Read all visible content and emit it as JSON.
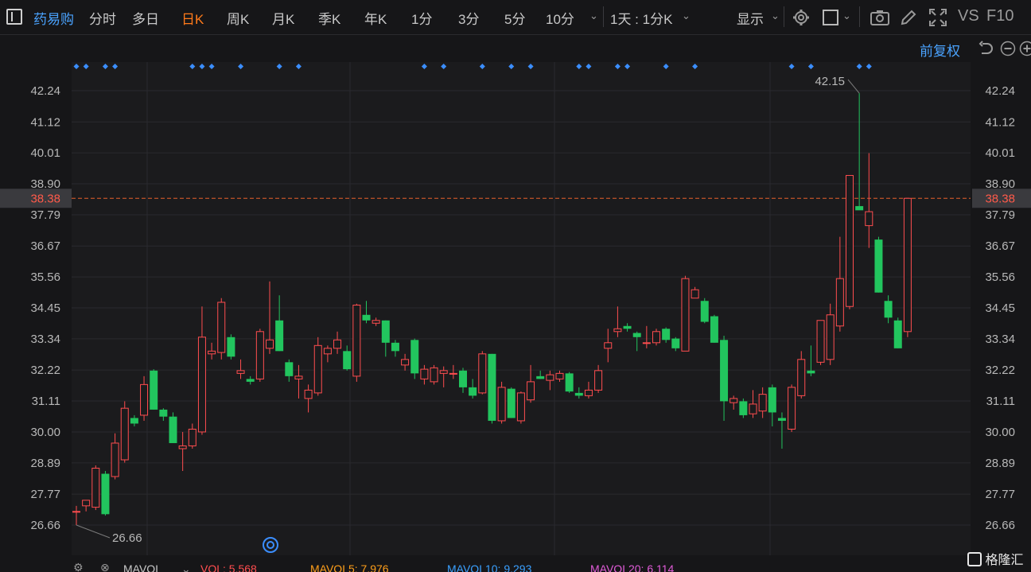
{
  "toolbar": {
    "stock_name": "药易购",
    "tabs": [
      "分时",
      "多日",
      "日K",
      "周K",
      "月K",
      "季K",
      "年K",
      "1分",
      "3分",
      "5分",
      "10分"
    ],
    "active_tab": "日K",
    "period_select": "1天 : 1分K",
    "display_label": "显示",
    "vs_label": "VS",
    "f10_label": "F10",
    "adjust_label": "前复权"
  },
  "chart_data": {
    "type": "candlestick",
    "y_ticks": [
      42.24,
      41.12,
      40.01,
      38.9,
      37.79,
      36.67,
      35.56,
      34.45,
      33.34,
      32.22,
      31.11,
      30.0,
      28.89,
      27.77,
      26.66
    ],
    "ylim": [
      25.9,
      43.2
    ],
    "current_price": 38.38,
    "high_label": "42.15",
    "low_label": "26.66",
    "up_color": "#ff4d4f",
    "down_color": "#22c55e",
    "ohlc": [
      [
        27.15,
        27.35,
        26.66,
        27.15
      ],
      [
        27.35,
        27.55,
        27.15,
        27.55
      ],
      [
        27.3,
        28.8,
        27.2,
        28.7
      ],
      [
        28.5,
        28.6,
        27.0,
        27.05
      ],
      [
        28.4,
        29.95,
        28.3,
        29.6
      ],
      [
        29.0,
        31.1,
        28.9,
        30.85
      ],
      [
        30.5,
        30.6,
        30.2,
        30.3
      ],
      [
        30.6,
        32.0,
        30.4,
        31.7
      ],
      [
        32.2,
        32.25,
        30.8,
        30.8
      ],
      [
        30.8,
        30.85,
        30.4,
        30.55
      ],
      [
        30.55,
        30.7,
        29.6,
        29.6
      ],
      [
        29.4,
        30.0,
        28.6,
        29.5
      ],
      [
        29.5,
        30.3,
        29.4,
        30.1
      ],
      [
        30.0,
        34.5,
        29.9,
        33.4
      ],
      [
        32.8,
        33.2,
        32.6,
        32.9
      ],
      [
        32.85,
        34.8,
        32.6,
        34.65
      ],
      [
        33.4,
        33.5,
        32.6,
        32.7
      ],
      [
        32.1,
        32.6,
        31.9,
        32.2
      ],
      [
        31.9,
        32.0,
        31.7,
        31.8
      ],
      [
        31.9,
        33.7,
        31.8,
        33.6
      ],
      [
        33.0,
        35.4,
        32.8,
        33.3
      ],
      [
        34.0,
        34.9,
        32.9,
        32.9
      ],
      [
        32.5,
        32.6,
        31.8,
        32.0
      ],
      [
        31.9,
        32.4,
        31.2,
        32.0
      ],
      [
        31.2,
        31.7,
        30.7,
        31.5
      ],
      [
        31.4,
        33.4,
        31.3,
        33.1
      ],
      [
        32.8,
        33.1,
        32.5,
        33.0
      ],
      [
        33.0,
        33.6,
        32.8,
        33.3
      ],
      [
        32.9,
        33.1,
        32.2,
        32.25
      ],
      [
        32.0,
        34.6,
        31.8,
        34.55
      ],
      [
        34.2,
        34.7,
        33.9,
        34.0
      ],
      [
        33.9,
        34.1,
        33.8,
        34.0
      ],
      [
        34.0,
        34.0,
        32.7,
        33.2
      ],
      [
        33.2,
        33.3,
        32.7,
        32.9
      ],
      [
        32.4,
        32.8,
        32.2,
        32.6
      ],
      [
        33.3,
        33.35,
        31.9,
        32.1
      ],
      [
        31.9,
        32.4,
        31.7,
        32.25
      ],
      [
        31.8,
        32.4,
        31.7,
        32.3
      ],
      [
        32.1,
        32.35,
        31.6,
        32.2
      ],
      [
        32.1,
        32.4,
        31.9,
        32.1
      ],
      [
        32.2,
        32.3,
        31.4,
        31.6
      ],
      [
        31.6,
        31.9,
        31.2,
        31.3
      ],
      [
        31.4,
        32.9,
        31.35,
        32.8
      ],
      [
        32.8,
        32.8,
        30.3,
        30.4
      ],
      [
        30.4,
        31.8,
        30.3,
        31.6
      ],
      [
        31.55,
        31.6,
        30.5,
        30.5
      ],
      [
        30.4,
        31.45,
        30.3,
        31.4
      ],
      [
        31.15,
        32.4,
        31.05,
        31.8
      ],
      [
        32.0,
        32.2,
        31.9,
        31.9
      ],
      [
        31.85,
        32.2,
        31.5,
        32.05
      ],
      [
        31.9,
        32.2,
        31.8,
        32.1
      ],
      [
        32.1,
        32.15,
        31.4,
        31.45
      ],
      [
        31.4,
        31.6,
        31.2,
        31.3
      ],
      [
        31.3,
        31.8,
        31.2,
        31.5
      ],
      [
        31.5,
        32.4,
        31.4,
        32.2
      ],
      [
        33.0,
        33.7,
        32.5,
        33.2
      ],
      [
        33.6,
        34.5,
        33.4,
        33.7
      ],
      [
        33.8,
        33.9,
        33.6,
        33.7
      ],
      [
        33.55,
        33.6,
        32.9,
        33.4
      ],
      [
        33.2,
        33.8,
        33.0,
        33.2
      ],
      [
        33.2,
        33.7,
        33.1,
        33.6
      ],
      [
        33.7,
        33.75,
        33.2,
        33.3
      ],
      [
        33.35,
        33.4,
        32.9,
        33.0
      ],
      [
        32.9,
        35.6,
        32.9,
        35.5
      ],
      [
        34.8,
        35.2,
        34.8,
        35.1
      ],
      [
        34.7,
        34.8,
        33.9,
        33.95
      ],
      [
        34.15,
        34.2,
        33.2,
        33.2
      ],
      [
        33.3,
        33.45,
        30.4,
        31.1
      ],
      [
        31.05,
        31.3,
        30.8,
        31.2
      ],
      [
        31.1,
        31.2,
        30.5,
        30.6
      ],
      [
        30.65,
        31.5,
        30.5,
        31.0
      ],
      [
        30.75,
        31.6,
        30.5,
        31.35
      ],
      [
        31.6,
        31.7,
        30.2,
        30.7
      ],
      [
        30.5,
        30.7,
        29.4,
        30.4
      ],
      [
        30.1,
        31.7,
        30.0,
        31.6
      ],
      [
        31.3,
        32.9,
        31.2,
        32.6
      ],
      [
        32.2,
        33.1,
        32.0,
        32.1
      ],
      [
        32.5,
        33.1,
        32.4,
        34.0
      ],
      [
        32.6,
        34.6,
        32.4,
        34.2
      ],
      [
        33.8,
        37.0,
        33.6,
        35.5
      ],
      [
        34.5,
        38.9,
        34.4,
        39.2
      ],
      [
        38.1,
        42.15,
        38.0,
        37.95
      ],
      [
        37.4,
        40.0,
        36.6,
        37.9
      ],
      [
        36.9,
        37.0,
        35.0,
        35.0
      ],
      [
        34.7,
        34.9,
        33.9,
        34.1
      ],
      [
        34.0,
        34.1,
        33.0,
        33.0
      ],
      [
        33.6,
        38.38,
        33.4,
        38.38
      ]
    ],
    "markers": [
      0,
      1,
      3,
      4,
      12,
      13,
      14,
      17,
      21,
      23,
      36,
      38,
      42,
      45,
      47,
      52,
      53,
      56,
      57,
      61,
      64,
      74,
      76,
      81,
      82
    ]
  },
  "bottom_bar": {
    "indicator": "MAVOL",
    "vol": "VOL: 5,568",
    "mavol5": "MAVOL5: 7,976",
    "mavol10": "MAVOL10: 9,293",
    "mavol20": "MAVOL20: 6,114"
  },
  "watermark": "格隆汇"
}
